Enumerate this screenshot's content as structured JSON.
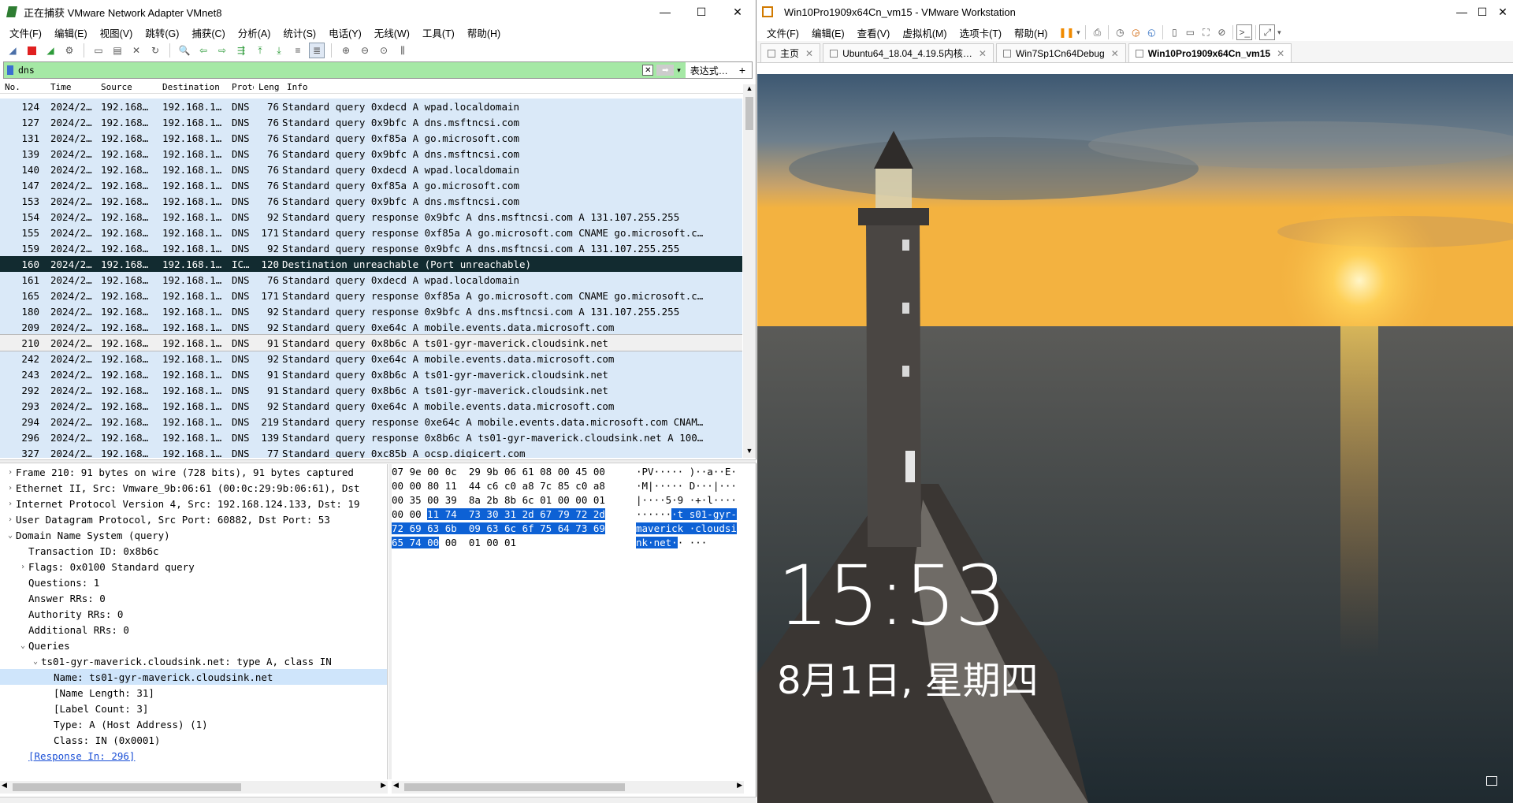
{
  "wireshark": {
    "title": "正在捕获 VMware Network Adapter VMnet8",
    "menu": [
      "文件(F)",
      "编辑(E)",
      "视图(V)",
      "跳转(G)",
      "捕获(C)",
      "分析(A)",
      "统计(S)",
      "电话(Y)",
      "无线(W)",
      "工具(T)",
      "帮助(H)"
    ],
    "filter": {
      "value": "dns",
      "expr_label": "表达式…",
      "plus": "+"
    },
    "columns": [
      "No.",
      "Time",
      "Source",
      "Destination",
      "Proto",
      "Leng",
      "Info"
    ],
    "packets": [
      {
        "no": "124",
        "time": "2024/2…",
        "src": "192.168…",
        "dst": "192.168.1…",
        "proto": "DNS",
        "len": "76",
        "info": "Standard query 0xdecd A wpad.localdomain"
      },
      {
        "no": "127",
        "time": "2024/2…",
        "src": "192.168…",
        "dst": "192.168.1…",
        "proto": "DNS",
        "len": "76",
        "info": "Standard query 0x9bfc A dns.msftncsi.com"
      },
      {
        "no": "131",
        "time": "2024/2…",
        "src": "192.168…",
        "dst": "192.168.1…",
        "proto": "DNS",
        "len": "76",
        "info": "Standard query 0xf85a A go.microsoft.com"
      },
      {
        "no": "139",
        "time": "2024/2…",
        "src": "192.168…",
        "dst": "192.168.1…",
        "proto": "DNS",
        "len": "76",
        "info": "Standard query 0x9bfc A dns.msftncsi.com"
      },
      {
        "no": "140",
        "time": "2024/2…",
        "src": "192.168…",
        "dst": "192.168.1…",
        "proto": "DNS",
        "len": "76",
        "info": "Standard query 0xdecd A wpad.localdomain"
      },
      {
        "no": "147",
        "time": "2024/2…",
        "src": "192.168…",
        "dst": "192.168.1…",
        "proto": "DNS",
        "len": "76",
        "info": "Standard query 0xf85a A go.microsoft.com"
      },
      {
        "no": "153",
        "time": "2024/2…",
        "src": "192.168…",
        "dst": "192.168.1…",
        "proto": "DNS",
        "len": "76",
        "info": "Standard query 0x9bfc A dns.msftncsi.com"
      },
      {
        "no": "154",
        "time": "2024/2…",
        "src": "192.168…",
        "dst": "192.168.1…",
        "proto": "DNS",
        "len": "92",
        "info": "Standard query response 0x9bfc A dns.msftncsi.com A 131.107.255.255"
      },
      {
        "no": "155",
        "time": "2024/2…",
        "src": "192.168…",
        "dst": "192.168.1…",
        "proto": "DNS",
        "len": "171",
        "info": "Standard query response 0xf85a A go.microsoft.com CNAME go.microsoft.c…"
      },
      {
        "no": "159",
        "time": "2024/2…",
        "src": "192.168…",
        "dst": "192.168.1…",
        "proto": "DNS",
        "len": "92",
        "info": "Standard query response 0x9bfc A dns.msftncsi.com A 131.107.255.255"
      },
      {
        "no": "160",
        "time": "2024/2…",
        "src": "192.168…",
        "dst": "192.168.1…",
        "proto": "IC…",
        "len": "120",
        "info": "Destination unreachable (Port unreachable)"
      },
      {
        "no": "161",
        "time": "2024/2…",
        "src": "192.168…",
        "dst": "192.168.1…",
        "proto": "DNS",
        "len": "76",
        "info": "Standard query 0xdecd A wpad.localdomain"
      },
      {
        "no": "165",
        "time": "2024/2…",
        "src": "192.168…",
        "dst": "192.168.1…",
        "proto": "DNS",
        "len": "171",
        "info": "Standard query response 0xf85a A go.microsoft.com CNAME go.microsoft.c…"
      },
      {
        "no": "180",
        "time": "2024/2…",
        "src": "192.168…",
        "dst": "192.168.1…",
        "proto": "DNS",
        "len": "92",
        "info": "Standard query response 0x9bfc A dns.msftncsi.com A 131.107.255.255"
      },
      {
        "no": "209",
        "time": "2024/2…",
        "src": "192.168…",
        "dst": "192.168.1…",
        "proto": "DNS",
        "len": "92",
        "info": "Standard query 0xe64c A mobile.events.data.microsoft.com"
      },
      {
        "no": "210",
        "time": "2024/2…",
        "src": "192.168…",
        "dst": "192.168.1…",
        "proto": "DNS",
        "len": "91",
        "info": "Standard query 0x8b6c A ts01-gyr-maverick.cloudsink.net"
      },
      {
        "no": "242",
        "time": "2024/2…",
        "src": "192.168…",
        "dst": "192.168.1…",
        "proto": "DNS",
        "len": "92",
        "info": "Standard query 0xe64c A mobile.events.data.microsoft.com"
      },
      {
        "no": "243",
        "time": "2024/2…",
        "src": "192.168…",
        "dst": "192.168.1…",
        "proto": "DNS",
        "len": "91",
        "info": "Standard query 0x8b6c A ts01-gyr-maverick.cloudsink.net"
      },
      {
        "no": "292",
        "time": "2024/2…",
        "src": "192.168…",
        "dst": "192.168.1…",
        "proto": "DNS",
        "len": "91",
        "info": "Standard query 0x8b6c A ts01-gyr-maverick.cloudsink.net"
      },
      {
        "no": "293",
        "time": "2024/2…",
        "src": "192.168…",
        "dst": "192.168.1…",
        "proto": "DNS",
        "len": "92",
        "info": "Standard query 0xe64c A mobile.events.data.microsoft.com"
      },
      {
        "no": "294",
        "time": "2024/2…",
        "src": "192.168…",
        "dst": "192.168.1…",
        "proto": "DNS",
        "len": "219",
        "info": "Standard query response 0xe64c A mobile.events.data.microsoft.com CNAM…"
      },
      {
        "no": "296",
        "time": "2024/2…",
        "src": "192.168…",
        "dst": "192.168.1…",
        "proto": "DNS",
        "len": "139",
        "info": "Standard query response 0x8b6c A ts01-gyr-maverick.cloudsink.net A 100…"
      },
      {
        "no": "327",
        "time": "2024/2…",
        "src": "192.168…",
        "dst": "192.168.1…",
        "proto": "DNS",
        "len": "77",
        "info": "Standard query 0xc85b A ocsp.digicert.com"
      }
    ],
    "details": [
      {
        "indent": 0,
        "tri": "›",
        "text": "Frame 210: 91 bytes on wire (728 bits), 91 bytes captured"
      },
      {
        "indent": 0,
        "tri": "›",
        "text": "Ethernet II, Src: Vmware_9b:06:61 (00:0c:29:9b:06:61), Dst"
      },
      {
        "indent": 0,
        "tri": "›",
        "text": "Internet Protocol Version 4, Src: 192.168.124.133, Dst: 19"
      },
      {
        "indent": 0,
        "tri": "›",
        "text": "User Datagram Protocol, Src Port: 60882, Dst Port: 53"
      },
      {
        "indent": 0,
        "tri": "⌄",
        "text": "Domain Name System (query)"
      },
      {
        "indent": 1,
        "tri": "",
        "text": "Transaction ID: 0x8b6c"
      },
      {
        "indent": 1,
        "tri": "›",
        "text": "Flags: 0x0100 Standard query"
      },
      {
        "indent": 1,
        "tri": "",
        "text": "Questions: 1"
      },
      {
        "indent": 1,
        "tri": "",
        "text": "Answer RRs: 0"
      },
      {
        "indent": 1,
        "tri": "",
        "text": "Authority RRs: 0"
      },
      {
        "indent": 1,
        "tri": "",
        "text": "Additional RRs: 0"
      },
      {
        "indent": 1,
        "tri": "⌄",
        "text": "Queries"
      },
      {
        "indent": 2,
        "tri": "⌄",
        "text": "ts01-gyr-maverick.cloudsink.net: type A, class IN"
      },
      {
        "indent": 3,
        "tri": "",
        "text": "Name: ts01-gyr-maverick.cloudsink.net",
        "hl": true
      },
      {
        "indent": 3,
        "tri": "",
        "text": "[Name Length: 31]"
      },
      {
        "indent": 3,
        "tri": "",
        "text": "[Label Count: 3]"
      },
      {
        "indent": 3,
        "tri": "",
        "text": "Type: A (Host Address) (1)"
      },
      {
        "indent": 3,
        "tri": "",
        "text": "Class: IN (0x0001)"
      },
      {
        "indent": 1,
        "tri": "",
        "text": "[Response In: 296]",
        "link": true
      }
    ],
    "bytes": [
      {
        "hex": [
          [
            "07 9e 00 0c  29 9b 06 61 08 00 45 00",
            false
          ]
        ],
        "ascii": [
          [
            "·PV····· )··a··E·",
            false
          ]
        ]
      },
      {
        "hex": [
          [
            "00 00 80 11  44 c6 c0 a8 7c 85 c0 a8",
            false
          ]
        ],
        "ascii": [
          [
            "·M|····· D···|···",
            false
          ]
        ]
      },
      {
        "hex": [
          [
            "00 35 00 39  8a 2b 8b 6c 01 00 00 01",
            false
          ]
        ],
        "ascii": [
          [
            "|····5·9 ·+·l····",
            false
          ]
        ]
      },
      {
        "hex": [
          [
            "00 00 ",
            false
          ],
          [
            "11 74  73 30 31 2d 67 79 72 2d",
            true
          ]
        ],
        "ascii": [
          [
            "······",
            false
          ],
          [
            "·t s01-gyr-",
            true
          ]
        ]
      },
      {
        "hex": [
          [
            "72 69 63 6b  09 63 6c 6f 75 64 73 69",
            true
          ]
        ],
        "ascii": [
          [
            "maverick ·cloudsi",
            true
          ]
        ]
      },
      {
        "hex": [
          [
            "65 74 00",
            true
          ],
          [
            " 00  01 00 01",
            false
          ]
        ],
        "ascii": [
          [
            "nk·net·",
            true
          ],
          [
            "· ···",
            false
          ]
        ]
      }
    ]
  },
  "vmware": {
    "title": "Win10Pro1909x64Cn_vm15 - VMware Workstation",
    "menu": [
      "文件(F)",
      "编辑(E)",
      "查看(V)",
      "虚拟机(M)",
      "选项卡(T)",
      "帮助(H)"
    ],
    "tabs": [
      {
        "label": "主页",
        "active": false
      },
      {
        "label": "Ubuntu64_18.04_4.19.5内核…",
        "active": false
      },
      {
        "label": "Win7Sp1Cn64Debug",
        "active": false
      },
      {
        "label": "Win10Pro1909x64Cn_vm15",
        "active": true
      }
    ],
    "lockscreen": {
      "time": "15:53",
      "date": "8月1日, 星期四"
    }
  }
}
